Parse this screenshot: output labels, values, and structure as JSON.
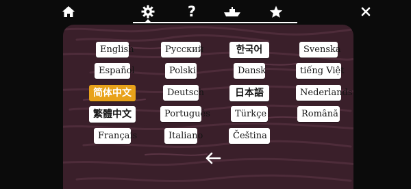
{
  "nav": {
    "home_icon": "home-icon",
    "settings_icon": "gear-icon",
    "help_icon": "question-icon",
    "boat_icon": "boat-icon",
    "star_icon": "star-icon",
    "close_icon": "close-icon",
    "help_label": "?"
  },
  "languages": {
    "col1": [
      "English",
      "Español",
      "简体中文",
      "繁體中文",
      "Français"
    ],
    "col2": [
      "Русский",
      "Polski",
      "Deutsch",
      "Português",
      "Italiano"
    ],
    "col3": [
      "한국어",
      "Dansk",
      "日本語",
      "Türkçe",
      "Čeština"
    ],
    "col4": [
      "Svenska",
      "tiếng Việt",
      "Nederlands",
      "Română"
    ],
    "selected": "简体中文"
  },
  "back_icon": "left-arrow-icon",
  "colors": {
    "background": "#0b0b0b",
    "panel": "#3a1f2a",
    "selected": "#e8a21a",
    "button": "#ffffff"
  }
}
